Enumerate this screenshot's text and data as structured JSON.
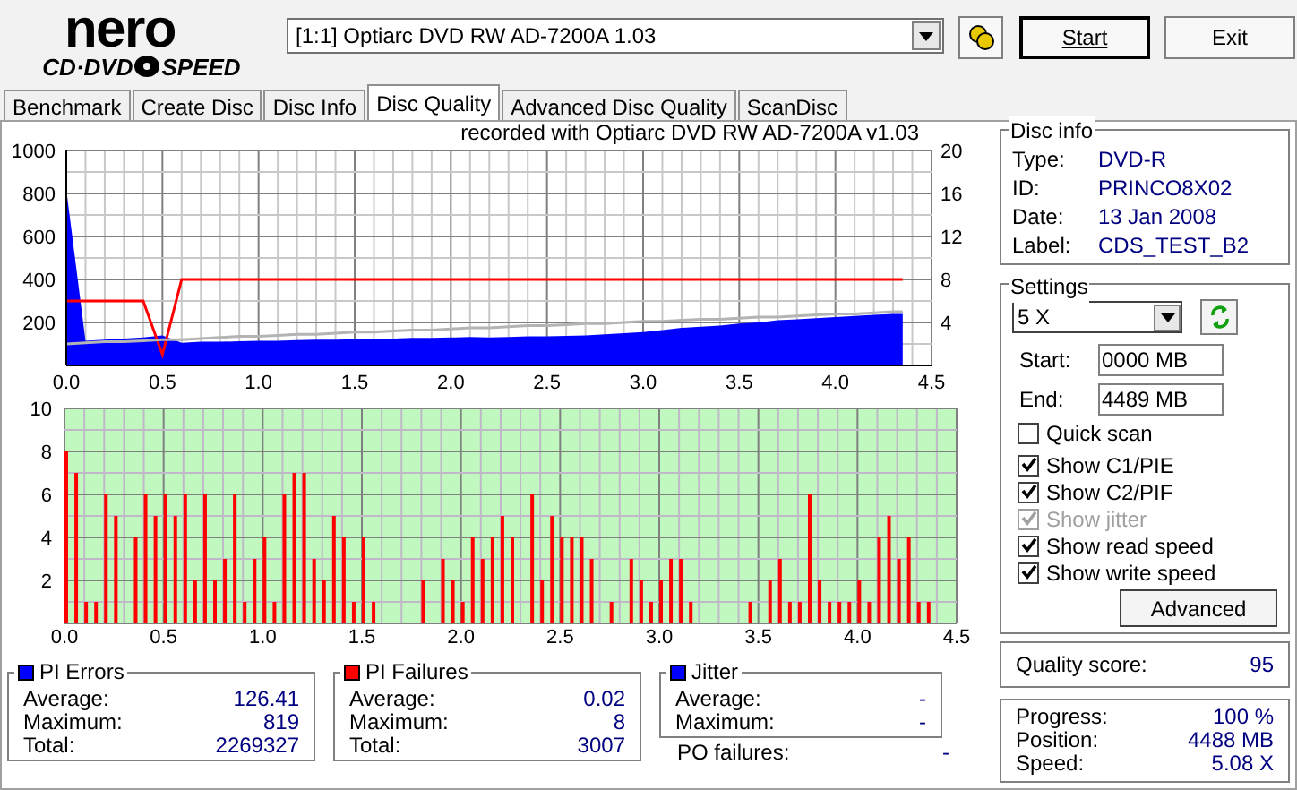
{
  "logo": {
    "brand": "nero",
    "left": "CD·DVD",
    "right": "SPEED"
  },
  "drive": {
    "value": "[1:1]  Optiarc DVD RW AD-7200A 1.03"
  },
  "buttons": {
    "start": "Start",
    "exit": "Exit"
  },
  "tabs": [
    {
      "label": "Benchmark",
      "selected": false
    },
    {
      "label": "Create Disc",
      "selected": false
    },
    {
      "label": "Disc Info",
      "selected": false
    },
    {
      "label": "Disc Quality",
      "selected": true
    },
    {
      "label": "Advanced Disc Quality",
      "selected": false
    },
    {
      "label": "ScanDisc",
      "selected": false
    }
  ],
  "top_chart": {
    "chart_data": {
      "type": "area",
      "grid": true,
      "title": "recorded with Optiarc DVD RW AD-7200A  v1.03",
      "xlim": [
        0,
        4.5
      ],
      "ylim": [
        0,
        1000
      ],
      "y2lim": [
        0,
        20
      ],
      "xticks": [
        {
          "value": 0,
          "label": "0.0"
        },
        {
          "value": 0.5,
          "label": "0.5"
        },
        {
          "value": 1,
          "label": "1.0"
        },
        {
          "value": 1.5,
          "label": "1.5"
        },
        {
          "value": 2,
          "label": "2.0"
        },
        {
          "value": 2.5,
          "label": "2.5"
        },
        {
          "value": 3,
          "label": "3.0"
        },
        {
          "value": 3.5,
          "label": "3.5"
        },
        {
          "value": 4,
          "label": "4.0"
        },
        {
          "value": 4.5,
          "label": "4.5"
        }
      ],
      "yticks": [
        200,
        400,
        600,
        800,
        1000
      ],
      "y2ticks": [
        4,
        8,
        12,
        16,
        20
      ],
      "x": [
        0,
        0.1,
        0.2,
        0.3,
        0.4,
        0.5,
        0.6,
        0.7,
        0.8,
        0.9,
        1,
        1.1,
        1.2,
        1.3,
        1.4,
        1.5,
        1.6,
        1.7,
        1.8,
        1.9,
        2,
        2.1,
        2.2,
        2.3,
        2.4,
        2.5,
        2.6,
        2.7,
        2.8,
        2.9,
        3,
        3.1,
        3.2,
        3.3,
        3.4,
        3.5,
        3.6,
        3.7,
        3.8,
        3.9,
        4,
        4.1,
        4.2,
        4.3,
        4.35
      ],
      "series": [
        {
          "type": "area",
          "color": "#0000ff",
          "values": [
            819,
            115,
            120,
            125,
            130,
            140,
            105,
            110,
            110,
            112,
            115,
            115,
            118,
            120,
            120,
            122,
            125,
            125,
            128,
            128,
            130,
            132,
            130,
            132,
            135,
            135,
            138,
            140,
            145,
            150,
            155,
            165,
            175,
            180,
            185,
            195,
            200,
            210,
            215,
            220,
            225,
            230,
            235,
            240,
            240
          ]
        },
        {
          "type": "line",
          "color": "#ff0000",
          "axis": "y2",
          "values": [
            6,
            6,
            6,
            6,
            6,
            1,
            8,
            8,
            8,
            8,
            8,
            8,
            8,
            8,
            8,
            8,
            8,
            8,
            8,
            8,
            8,
            8,
            8,
            8,
            8,
            8,
            8,
            8,
            8,
            8,
            8,
            8,
            8,
            8,
            8,
            8,
            8,
            8,
            8,
            8,
            8,
            8,
            8,
            8,
            8
          ]
        },
        {
          "type": "line",
          "color": "#b4b4b4",
          "axis": "y2",
          "values": [
            2,
            2.1,
            2.2,
            2.2,
            2.3,
            2.4,
            2.4,
            2.5,
            2.6,
            2.7,
            2.7,
            2.8,
            2.9,
            2.9,
            3,
            3.1,
            3.1,
            3.2,
            3.3,
            3.3,
            3.4,
            3.5,
            3.5,
            3.6,
            3.7,
            3.7,
            3.8,
            3.9,
            3.9,
            4,
            4.1,
            4.1,
            4.2,
            4.3,
            4.3,
            4.4,
            4.5,
            4.5,
            4.6,
            4.7,
            4.8,
            4.8,
            4.9,
            5,
            5
          ]
        }
      ]
    }
  },
  "bottom_chart": {
    "chart_data": {
      "type": "bar",
      "grid": true,
      "xlim": [
        0,
        4.5
      ],
      "ylim": [
        0,
        10
      ],
      "xticks": [
        {
          "value": 0,
          "label": "0.0"
        },
        {
          "value": 0.5,
          "label": "0.5"
        },
        {
          "value": 1,
          "label": "1.0"
        },
        {
          "value": 1.5,
          "label": "1.5"
        },
        {
          "value": 2,
          "label": "2.0"
        },
        {
          "value": 2.5,
          "label": "2.5"
        },
        {
          "value": 3,
          "label": "3.0"
        },
        {
          "value": 3.5,
          "label": "3.5"
        },
        {
          "value": 4,
          "label": "4.0"
        },
        {
          "value": 4.5,
          "label": "4.5"
        }
      ],
      "yticks": [
        2,
        4,
        6,
        8,
        10
      ],
      "x": [
        0,
        0.05,
        0.1,
        0.15,
        0.2,
        0.25,
        0.3,
        0.35,
        0.4,
        0.45,
        0.5,
        0.55,
        0.6,
        0.65,
        0.7,
        0.75,
        0.8,
        0.85,
        0.9,
        0.95,
        1,
        1.05,
        1.1,
        1.15,
        1.2,
        1.25,
        1.3,
        1.35,
        1.4,
        1.45,
        1.5,
        1.55,
        1.6,
        1.65,
        1.7,
        1.75,
        1.8,
        1.85,
        1.9,
        1.95,
        2,
        2.05,
        2.1,
        2.15,
        2.2,
        2.25,
        2.3,
        2.35,
        2.4,
        2.45,
        2.5,
        2.55,
        2.6,
        2.65,
        2.7,
        2.75,
        2.8,
        2.85,
        2.9,
        2.95,
        3,
        3.05,
        3.1,
        3.15,
        3.2,
        3.25,
        3.3,
        3.35,
        3.4,
        3.45,
        3.5,
        3.55,
        3.6,
        3.65,
        3.7,
        3.75,
        3.8,
        3.85,
        3.9,
        3.95,
        4,
        4.05,
        4.1,
        4.15,
        4.2,
        4.25,
        4.3,
        4.35
      ],
      "series": [
        {
          "color": "#ff0000",
          "values": [
            8,
            7,
            1,
            1,
            6,
            5,
            0,
            4,
            6,
            5,
            6,
            5,
            6,
            2,
            6,
            2,
            3,
            6,
            1,
            3,
            4,
            1,
            6,
            7,
            7,
            3,
            2,
            5,
            4,
            1,
            4,
            1,
            0,
            0,
            0,
            0,
            2,
            0,
            3,
            2,
            1,
            4,
            3,
            4,
            5,
            4,
            0,
            6,
            2,
            5,
            4,
            4,
            4,
            3,
            0,
            1,
            0,
            3,
            2,
            1,
            2,
            3,
            3,
            1,
            0,
            0,
            0,
            0,
            0,
            1,
            0,
            2,
            3,
            1,
            1,
            6,
            2,
            1,
            1,
            1,
            2,
            1,
            4,
            5,
            3,
            4,
            1,
            1
          ]
        }
      ]
    }
  },
  "disc_info": {
    "title": "Disc info",
    "rows": [
      {
        "label": "Type:",
        "value": "DVD-R"
      },
      {
        "label": "ID:",
        "value": "PRINCO8X02"
      },
      {
        "label": "Date:",
        "value": "13 Jan 2008"
      },
      {
        "label": "Label:",
        "value": "CDS_TEST_B2"
      }
    ]
  },
  "settings": {
    "title": "Settings",
    "speed": "5 X",
    "start_label": "Start:",
    "start": "0000 MB",
    "end_label": "End:",
    "end": "4489 MB",
    "options": [
      {
        "label": "Quick scan",
        "checked": false,
        "disabled": false
      },
      {
        "label": "Show C1/PIE",
        "checked": true,
        "disabled": false
      },
      {
        "label": "Show C2/PIF",
        "checked": true,
        "disabled": false
      },
      {
        "label": "Show jitter",
        "checked": true,
        "disabled": true
      },
      {
        "label": "Show read speed",
        "checked": true,
        "disabled": false
      },
      {
        "label": "Show write speed",
        "checked": true,
        "disabled": false
      }
    ],
    "advanced": "Advanced"
  },
  "quality": {
    "label": "Quality score:",
    "value": "95"
  },
  "progress": [
    {
      "label": "Progress:",
      "value": "100 %"
    },
    {
      "label": "Position:",
      "value": "4488 MB"
    },
    {
      "label": "Speed:",
      "value": "5.08 X"
    }
  ],
  "stats": [
    {
      "title": "PI Errors",
      "color": "#0000ff",
      "rows": [
        {
          "label": "Average:",
          "value": "126.41"
        },
        {
          "label": "Maximum:",
          "value": "819"
        },
        {
          "label": "Total:",
          "value": "2269327"
        }
      ]
    },
    {
      "title": "PI Failures",
      "color": "#ff0000",
      "rows": [
        {
          "label": "Average:",
          "value": "0.02"
        },
        {
          "label": "Maximum:",
          "value": "8"
        },
        {
          "label": "Total:",
          "value": "3007"
        }
      ]
    },
    {
      "title": "Jitter",
      "color": "#0000ff",
      "rows": [
        {
          "label": "Average:",
          "value": "-"
        },
        {
          "label": "Maximum:",
          "value": "-"
        }
      ]
    }
  ],
  "po_failures": {
    "label": "PO failures:",
    "value": "-"
  }
}
